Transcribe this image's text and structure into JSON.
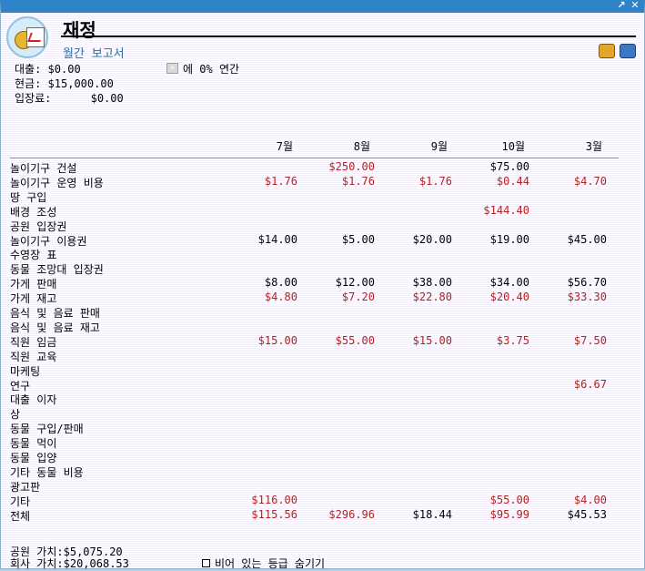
{
  "window": {
    "title": "재정",
    "subtitle": "월간 보고서"
  },
  "summary": {
    "loan_label": "대출:",
    "loan_value": "$0.00",
    "interest_prefix": "에",
    "interest_text": "0% 연간",
    "cash_label": "현금:",
    "cash_value": "$15,000.00",
    "fee_label": "입장료:",
    "fee_value": "$0.00"
  },
  "months": [
    "7월",
    "8월",
    "9월",
    "10월",
    "3월"
  ],
  "rows": [
    {
      "name": "놀이기구 건설",
      "values": [
        "",
        "$250.00",
        "",
        "$75.00",
        ""
      ],
      "neg": [
        false,
        true,
        false,
        false,
        false
      ]
    },
    {
      "name": "놀이기구 운영 비용",
      "values": [
        "$1.76",
        "$1.76",
        "$1.76",
        "$0.44",
        "$4.70"
      ],
      "neg": [
        true,
        true,
        true,
        true,
        true
      ]
    },
    {
      "name": "땅 구입",
      "values": [
        "",
        "",
        "",
        "",
        ""
      ],
      "neg": [
        false,
        false,
        false,
        false,
        false
      ]
    },
    {
      "name": "배경 조성",
      "values": [
        "",
        "",
        "",
        "$144.40",
        ""
      ],
      "neg": [
        false,
        false,
        false,
        true,
        false
      ]
    },
    {
      "name": "공원 입장권",
      "values": [
        "",
        "",
        "",
        "",
        ""
      ],
      "neg": [
        false,
        false,
        false,
        false,
        false
      ]
    },
    {
      "name": "놀이기구 이용권",
      "values": [
        "$14.00",
        "$5.00",
        "$20.00",
        "$19.00",
        "$45.00"
      ],
      "neg": [
        false,
        false,
        false,
        false,
        false
      ]
    },
    {
      "name": "수영장 표",
      "values": [
        "",
        "",
        "",
        "",
        ""
      ],
      "neg": [
        false,
        false,
        false,
        false,
        false
      ]
    },
    {
      "name": "동물 조망대 입장권",
      "values": [
        "",
        "",
        "",
        "",
        ""
      ],
      "neg": [
        false,
        false,
        false,
        false,
        false
      ]
    },
    {
      "name": "가게 판매",
      "values": [
        "$8.00",
        "$12.00",
        "$38.00",
        "$34.00",
        "$56.70"
      ],
      "neg": [
        false,
        false,
        false,
        false,
        false
      ]
    },
    {
      "name": "가게 재고",
      "values": [
        "$4.80",
        "$7.20",
        "$22.80",
        "$20.40",
        "$33.30"
      ],
      "neg": [
        true,
        true,
        true,
        true,
        true
      ]
    },
    {
      "name": "음식 및 음료 판매",
      "values": [
        "",
        "",
        "",
        "",
        ""
      ],
      "neg": [
        false,
        false,
        false,
        false,
        false
      ]
    },
    {
      "name": "음식 및 음료 재고",
      "values": [
        "",
        "",
        "",
        "",
        ""
      ],
      "neg": [
        false,
        false,
        false,
        false,
        false
      ]
    },
    {
      "name": "직원 임금",
      "values": [
        "$15.00",
        "$55.00",
        "$15.00",
        "$3.75",
        "$7.50"
      ],
      "neg": [
        true,
        true,
        true,
        true,
        true
      ]
    },
    {
      "name": "직원 교육",
      "values": [
        "",
        "",
        "",
        "",
        ""
      ],
      "neg": [
        false,
        false,
        false,
        false,
        false
      ]
    },
    {
      "name": "마케팅",
      "values": [
        "",
        "",
        "",
        "",
        ""
      ],
      "neg": [
        false,
        false,
        false,
        false,
        false
      ]
    },
    {
      "name": "연구",
      "values": [
        "",
        "",
        "",
        "",
        "$6.67"
      ],
      "neg": [
        false,
        false,
        false,
        false,
        true
      ]
    },
    {
      "name": "대출 이자",
      "values": [
        "",
        "",
        "",
        "",
        ""
      ],
      "neg": [
        false,
        false,
        false,
        false,
        false
      ]
    },
    {
      "name": "상",
      "values": [
        "",
        "",
        "",
        "",
        ""
      ],
      "neg": [
        false,
        false,
        false,
        false,
        false
      ]
    },
    {
      "name": "동물 구입/판매",
      "values": [
        "",
        "",
        "",
        "",
        ""
      ],
      "neg": [
        false,
        false,
        false,
        false,
        false
      ]
    },
    {
      "name": "동물 먹이",
      "values": [
        "",
        "",
        "",
        "",
        ""
      ],
      "neg": [
        false,
        false,
        false,
        false,
        false
      ]
    },
    {
      "name": "동물 입양",
      "values": [
        "",
        "",
        "",
        "",
        ""
      ],
      "neg": [
        false,
        false,
        false,
        false,
        false
      ]
    },
    {
      "name": "기타 동물 비용",
      "values": [
        "",
        "",
        "",
        "",
        ""
      ],
      "neg": [
        false,
        false,
        false,
        false,
        false
      ]
    },
    {
      "name": "광고판",
      "values": [
        "",
        "",
        "",
        "",
        ""
      ],
      "neg": [
        false,
        false,
        false,
        false,
        false
      ]
    },
    {
      "name": "기타",
      "values": [
        "$116.00",
        "",
        "",
        "$55.00",
        "$4.00"
      ],
      "neg": [
        true,
        false,
        false,
        true,
        true
      ]
    },
    {
      "name": "전체",
      "values": [
        "$115.56",
        "$296.96",
        "$18.44",
        "$95.99",
        "$45.53"
      ],
      "neg": [
        true,
        true,
        false,
        true,
        false
      ]
    }
  ],
  "footer": {
    "park_value_label": "공원 가치:",
    "park_value": "$5,075.20",
    "company_value_label": "회사 가치:",
    "company_value": "$20,068.53",
    "hide_empty_label": "비어 있는 등급 숨기기"
  },
  "colors": {
    "negative": "#b22222",
    "accent": "#2a6f99",
    "titlebar": "#2f84c9"
  },
  "icons": [
    "resize-icon",
    "close-icon",
    "finance-logo-icon",
    "coins-icon",
    "chart-icon"
  ]
}
